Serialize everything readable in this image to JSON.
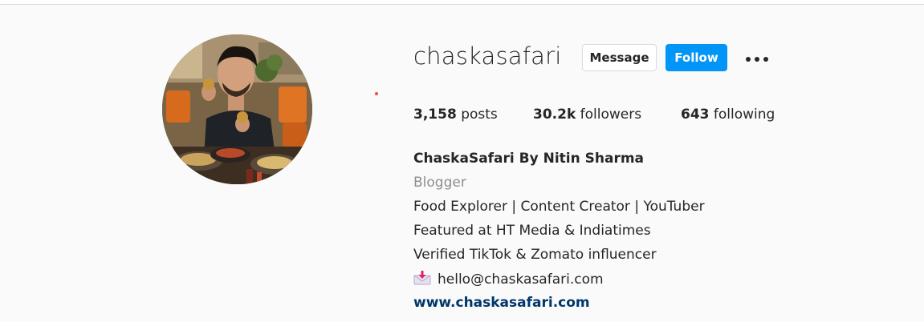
{
  "profile": {
    "username": "chaskasafari",
    "message_label": "Message",
    "follow_label": "Follow",
    "more_icon": "more-options-icon"
  },
  "stats": {
    "posts_count": "3,158",
    "posts_label": "posts",
    "followers_count": "30.2k",
    "followers_label": "followers",
    "following_count": "643",
    "following_label": "following"
  },
  "bio": {
    "name": "ChaskaSafari By Nitin Sharma",
    "category": "Blogger",
    "lines": [
      "Food Explorer | Content Creator | YouTuber",
      "Featured at HT Media & Indiatimes",
      "Verified TikTok & Zomato influencer"
    ],
    "email_icon": "envelope-arrow-icon",
    "email": "hello@chaskasafari.com",
    "website": "www.chaskasafari.com"
  },
  "colors": {
    "follow_button": "#0095f6",
    "link": "#00376b",
    "notification_dot": "#ed4956",
    "category_text": "#8e8e8e"
  }
}
